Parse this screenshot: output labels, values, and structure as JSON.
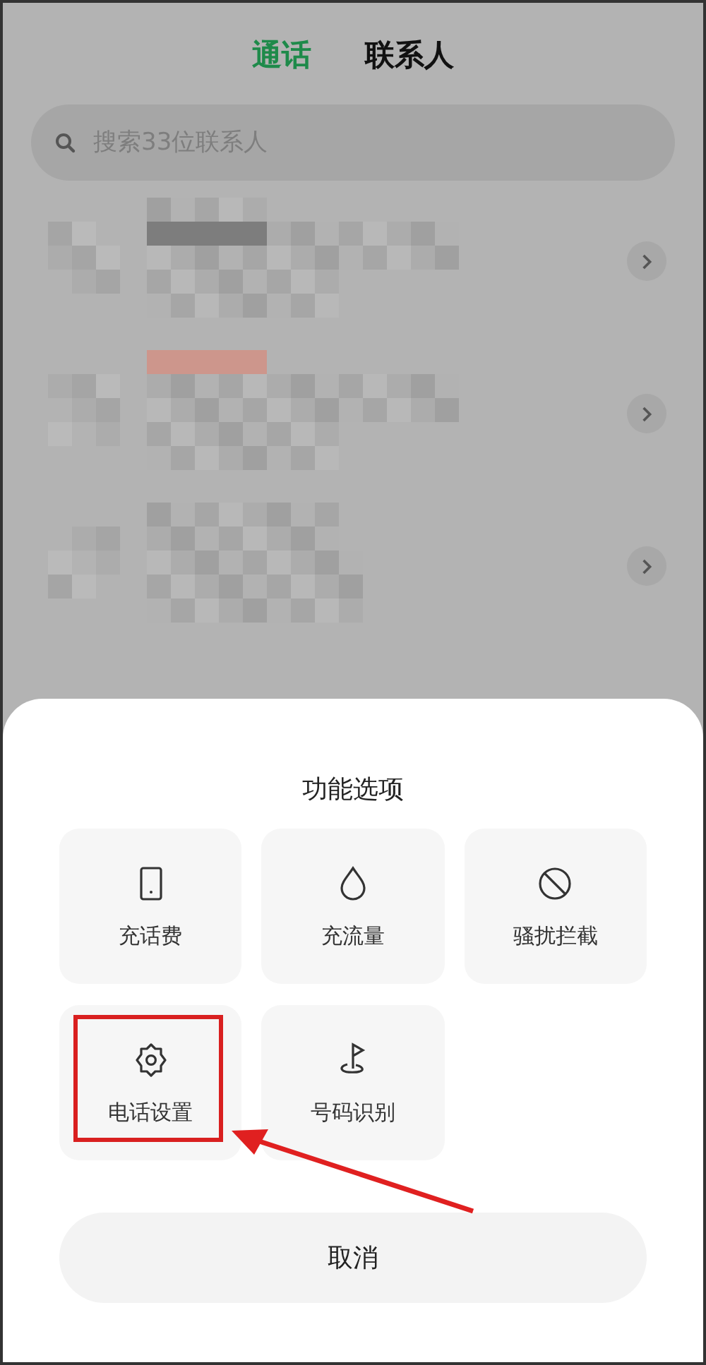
{
  "tabs": [
    {
      "label": "通话",
      "selected": true
    },
    {
      "label": "联系人",
      "selected": false
    }
  ],
  "search": {
    "placeholder": "搜索33位联系人"
  },
  "contacts": [
    {
      "kind": "pixelated"
    },
    {
      "kind": "pixelated"
    },
    {
      "kind": "pixelated"
    }
  ],
  "sheet": {
    "title": "功能选项",
    "items": [
      {
        "label": "充话费",
        "kind": "phone",
        "highlighted": false
      },
      {
        "label": "充流量",
        "kind": "drop",
        "highlighted": false
      },
      {
        "label": "骚扰拦截",
        "kind": "block",
        "highlighted": false
      },
      {
        "label": "电话设置",
        "kind": "gear",
        "highlighted": true
      },
      {
        "label": "号码识别",
        "kind": "flag",
        "highlighted": false
      }
    ],
    "cancel": "取消"
  }
}
